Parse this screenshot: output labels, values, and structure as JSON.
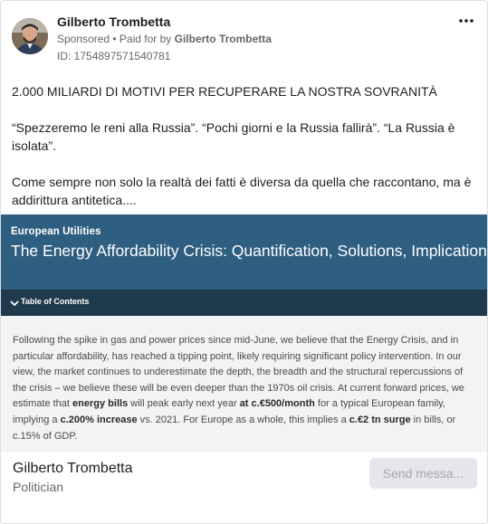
{
  "post": {
    "author_name": "Gilberto Trombetta",
    "sponsored_label": "Sponsored",
    "paid_for_prefix": " • Paid for by ",
    "paid_for_name": "Gilberto Trombetta",
    "id_text": "ID: 1754897571540781",
    "more_icon": "more-horizontal-icon",
    "paragraphs": [
      "2.000 MILIARDI DI MOTIVI PER RECUPERARE LA NOSTRA SOVRANITÀ",
      "“Spezzeremo le reni alla Russia”. “Pochi giorni e la Russia fallirà”. “La Russia è isolata”.",
      "Come sempre non solo la realtà dei fatti è diversa da quella che raccontano, ma è addirittura antitetica...."
    ]
  },
  "creative": {
    "kicker": "European Utilities",
    "title": "The Energy Affordability Crisis: Quantification, Solutions, Implications",
    "toc_label": "Table of Contents",
    "excerpt_parts": {
      "p1": "Following the spike in gas and power prices since mid-June, we believe that the Energy Crisis, and in particular affordability, has reached a tipping point, likely requiring significant policy intervention. In our view, the market continues to underestimate the depth, the breadth and the structural repercussions of the crisis – we believe these will be even deeper than the 1970s oil crisis. At current forward prices, we estimate that ",
      "b1": "energy bills",
      "p2": " will peak early next year ",
      "b2": "at c.€500/month",
      "p3": " for a typical European family, implying a ",
      "b3": "c.200% increase",
      "p4": " vs. 2021. For Europe as a whole, this implies a ",
      "b4": "c.€2 tn surge",
      "p5": " in bills, or c.15% of GDP."
    },
    "colors": {
      "banner": "#2e5e80",
      "toc_bar": "#1f3a4c",
      "excerpt_bg": "#f3f3f3"
    }
  },
  "footer": {
    "name": "Gilberto Trombetta",
    "role": "Politician",
    "send_button_label": "Send messa..."
  }
}
